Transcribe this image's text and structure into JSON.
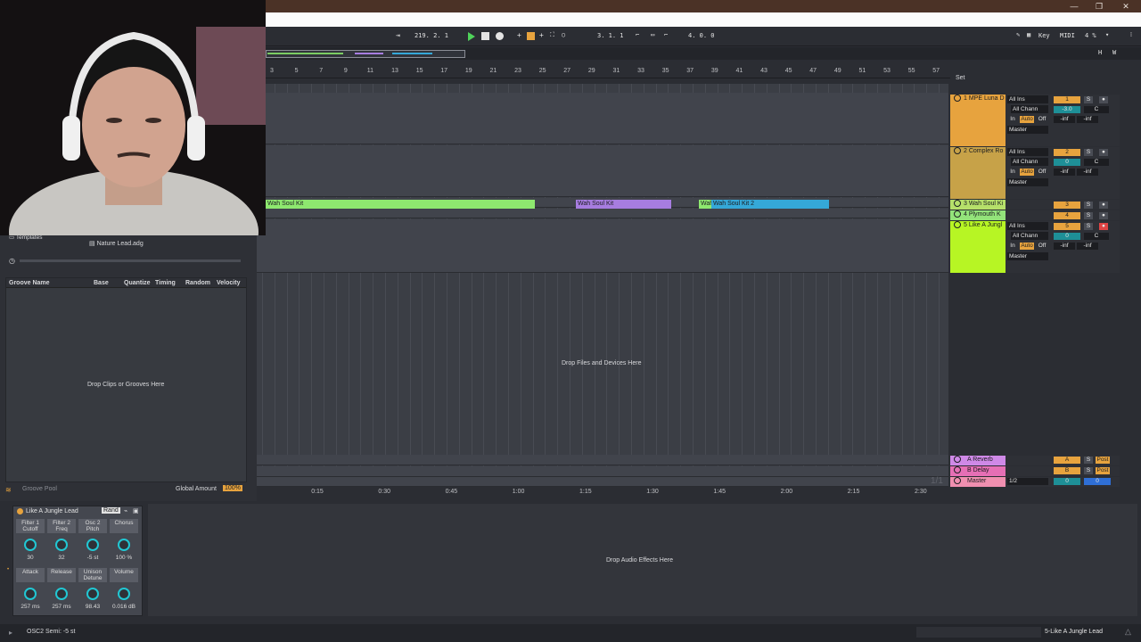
{
  "transport": {
    "tempo_pos": "219. 2. 1",
    "position": "3. 1. 1",
    "length": "4. 0. 0",
    "key_label": "Key",
    "midi_label": "MIDI",
    "cpu": "4 %",
    "h_label": "H",
    "w_label": "W"
  },
  "ruler": {
    "bars": [
      "3",
      "5",
      "7",
      "9",
      "11",
      "13",
      "15",
      "17",
      "19",
      "21",
      "23",
      "25",
      "27",
      "29",
      "31",
      "33",
      "35",
      "37",
      "39",
      "41",
      "43",
      "45",
      "47",
      "49",
      "51",
      "53",
      "55",
      "57"
    ],
    "times": [
      "0:15",
      "0:30",
      "0:45",
      "1:00",
      "1:15",
      "1:30",
      "1:45",
      "2:00",
      "2:15",
      "2:30"
    ]
  },
  "set_label": "Set",
  "arrangement": {
    "drop_text": "Drop Files and Devices Here",
    "clips": [
      {
        "label": "Wah Soul Kit",
        "color": "#8ee86f"
      },
      {
        "label": "Wah Soul Kit",
        "color": "#a77de0"
      },
      {
        "label": "Wah",
        "color": "#8ee86f"
      },
      {
        "label": "Wah Soul Kit 2",
        "color": "#35a8d8"
      }
    ]
  },
  "tracks": [
    {
      "name": "1 MPE Luna D",
      "color": "#e7a33e",
      "input": "All Ins",
      "channel": "All Chann",
      "num": "1",
      "vol": "-3.0",
      "pan": "C",
      "out": "Master",
      "in": "In",
      "auto": "Auto",
      "off": "Off",
      "inf1": "-inf",
      "inf2": "-inf"
    },
    {
      "name": "2 Complex Ro",
      "color": "#c7a248",
      "input": "All Ins",
      "channel": "All Chann",
      "num": "2",
      "vol": "0",
      "pan": "C",
      "out": "Master",
      "in": "In",
      "auto": "Auto",
      "off": "Off",
      "inf1": "-inf",
      "inf2": "-inf"
    },
    {
      "name": "3 Wah Soul Ki",
      "color": "#b6e06a",
      "num": "3"
    },
    {
      "name": "4 Plymouth K",
      "color": "#93e37a",
      "num": "4"
    },
    {
      "name": "5 Like A Jungl",
      "color": "#b7f524",
      "input": "All Ins",
      "channel": "All Chann",
      "num": "5",
      "vol": "0",
      "pan": "C",
      "out": "Master",
      "in": "In",
      "auto": "Auto",
      "off": "Off",
      "inf1": "-inf",
      "inf2": "-inf"
    }
  ],
  "returns": [
    {
      "name": "A Reverb",
      "color": "#cf89e7",
      "letter": "A",
      "post": "Post"
    },
    {
      "name": "B Delay",
      "color": "#e66fb5",
      "letter": "B",
      "post": "Post"
    },
    {
      "name": "Master",
      "color": "#f08fb0",
      "sel": "1/2",
      "v1": "0",
      "v2": "0"
    }
  ],
  "browser": {
    "templates": "Templates",
    "file1": "Nature Lead.adg"
  },
  "groove": {
    "headers": [
      "Groove Name",
      "Base",
      "Quantize",
      "Timing",
      "Random",
      "Velocity"
    ],
    "drop_text": "Drop Clips or Grooves Here",
    "pool": "Groove Pool",
    "global_amount_label": "Global Amount",
    "global_amount": "100%"
  },
  "device": {
    "name": "Like A Jungle Lead",
    "rand": "Rand",
    "knobs": [
      {
        "label": "Filter 1 Cutoff",
        "value": "30"
      },
      {
        "label": "Filter 2 Freq",
        "value": "32"
      },
      {
        "label": "Osc 2 Pitch",
        "value": "-5 st"
      },
      {
        "label": "Chorus",
        "value": "100 %"
      },
      {
        "label": "Attack",
        "value": "257 ms"
      },
      {
        "label": "Release",
        "value": "257 ms"
      },
      {
        "label": "Unison Detune",
        "value": "98.43"
      },
      {
        "label": "Volume",
        "value": "0.016 dB"
      }
    ],
    "drop_effects": "Drop Audio Effects Here"
  },
  "status": {
    "left": "OSC2 Semi: -5 st",
    "right": "5-Like A Jungle Lead"
  },
  "pager": "1/1"
}
